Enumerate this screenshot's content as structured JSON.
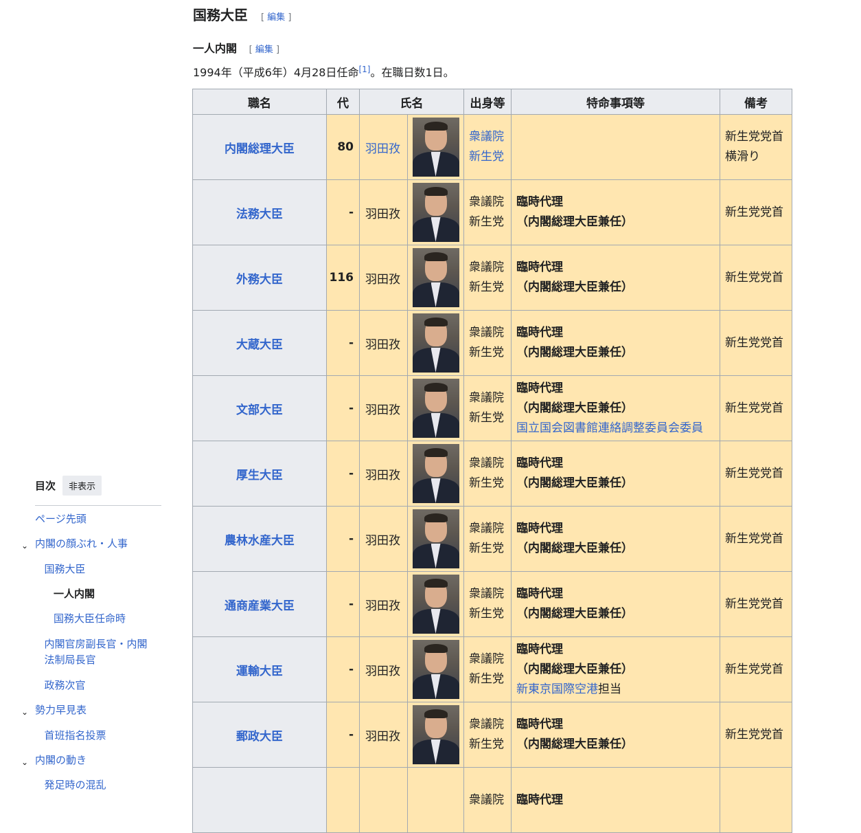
{
  "heading": {
    "title": "国務大臣",
    "edit_open": "[",
    "edit_label": "編集",
    "edit_close": "]"
  },
  "subheading": {
    "title": "一人内閣",
    "edit_open": "[",
    "edit_label": "編集",
    "edit_close": "]"
  },
  "intro": {
    "text": "1994年（平成6年）4月28日任命",
    "ref": "[1]",
    "after": "。在職日数1日。"
  },
  "table": {
    "headers": [
      "職名",
      "代",
      "氏名",
      "出身等",
      "特命事項等",
      "備考"
    ],
    "rows": [
      {
        "post": "内閣総理大臣",
        "num": "80",
        "name": "羽田孜",
        "name_link": true,
        "origin1": "衆議院",
        "origin2": "新生党",
        "origin_link": true,
        "special1": "",
        "special2": "",
        "special3": "",
        "special3_suffix": "",
        "notes1": "新生党党首",
        "notes2": "横滑り"
      },
      {
        "post": "法務大臣",
        "num": "-",
        "name": "羽田孜",
        "origin1": "衆議院",
        "origin2": "新生党",
        "special1": "臨時代理",
        "special2": "（内閣総理大臣兼任）",
        "special3": "",
        "special3_suffix": "",
        "notes1": "新生党党首",
        "notes2": ""
      },
      {
        "post": "外務大臣",
        "num": "116",
        "name": "羽田孜",
        "origin1": "衆議院",
        "origin2": "新生党",
        "special1": "臨時代理",
        "special2": "（内閣総理大臣兼任）",
        "special3": "",
        "special3_suffix": "",
        "notes1": "新生党党首",
        "notes2": ""
      },
      {
        "post": "大蔵大臣",
        "num": "-",
        "name": "羽田孜",
        "origin1": "衆議院",
        "origin2": "新生党",
        "special1": "臨時代理",
        "special2": "（内閣総理大臣兼任）",
        "special3": "",
        "special3_suffix": "",
        "notes1": "新生党党首",
        "notes2": ""
      },
      {
        "post": "文部大臣",
        "num": "-",
        "name": "羽田孜",
        "origin1": "衆議院",
        "origin2": "新生党",
        "special1": "臨時代理",
        "special2": "（内閣総理大臣兼任）",
        "special3": "国立国会図書館連絡調整委員会委員",
        "special3_suffix": "",
        "notes1": "新生党党首",
        "notes2": ""
      },
      {
        "post": "厚生大臣",
        "num": "-",
        "name": "羽田孜",
        "origin1": "衆議院",
        "origin2": "新生党",
        "special1": "臨時代理",
        "special2": "（内閣総理大臣兼任）",
        "special3": "",
        "special3_suffix": "",
        "notes1": "新生党党首",
        "notes2": ""
      },
      {
        "post": "農林水産大臣",
        "num": "-",
        "name": "羽田孜",
        "origin1": "衆議院",
        "origin2": "新生党",
        "special1": "臨時代理",
        "special2": "（内閣総理大臣兼任）",
        "special3": "",
        "special3_suffix": "",
        "notes1": "新生党党首",
        "notes2": ""
      },
      {
        "post": "通商産業大臣",
        "num": "-",
        "name": "羽田孜",
        "origin1": "衆議院",
        "origin2": "新生党",
        "special1": "臨時代理",
        "special2": "（内閣総理大臣兼任）",
        "special3": "",
        "special3_suffix": "",
        "notes1": "新生党党首",
        "notes2": ""
      },
      {
        "post": "運輸大臣",
        "num": "-",
        "name": "羽田孜",
        "origin1": "衆議院",
        "origin2": "新生党",
        "special1": "臨時代理",
        "special2": "（内閣総理大臣兼任）",
        "special3": "新東京国際空港",
        "special3_suffix": "担当",
        "notes1": "新生党党首",
        "notes2": ""
      },
      {
        "post": "郵政大臣",
        "num": "-",
        "name": "羽田孜",
        "origin1": "衆議院",
        "origin2": "新生党",
        "special1": "臨時代理",
        "special2": "（内閣総理大臣兼任）",
        "special3": "",
        "special3_suffix": "",
        "notes1": "新生党党首",
        "notes2": ""
      },
      {
        "post": "",
        "num": "",
        "name": "",
        "origin1": "衆議院",
        "origin2": "",
        "special1": "臨時代理",
        "special2": "",
        "special3": "",
        "special3_suffix": "",
        "notes1": "",
        "notes2": ""
      }
    ]
  },
  "toc": {
    "title": "目次",
    "hide_label": "非表示",
    "items": [
      {
        "label": "ページ先頭",
        "level": 0,
        "chevron": false,
        "active": false
      },
      {
        "label": "内閣の顔ぶれ・人事",
        "level": 0,
        "chevron": true,
        "active": false
      },
      {
        "label": "国務大臣",
        "level": 1,
        "chevron": false,
        "active": false
      },
      {
        "label": "一人内閣",
        "level": 2,
        "chevron": false,
        "active": true
      },
      {
        "label": "国務大臣任命時",
        "level": 2,
        "chevron": false,
        "active": false
      },
      {
        "label": "内閣官房副長官・内閣",
        "label2": "法制局長官",
        "level": 1,
        "chevron": false,
        "active": false
      },
      {
        "label": "政務次官",
        "level": 1,
        "chevron": false,
        "active": false
      },
      {
        "label": "勢力早見表",
        "level": 0,
        "chevron": true,
        "active": false
      },
      {
        "label": "首班指名投票",
        "level": 1,
        "chevron": false,
        "active": false
      },
      {
        "label": "内閣の動き",
        "level": 0,
        "chevron": true,
        "active": false
      },
      {
        "label": "発足時の混乱",
        "level": 1,
        "chevron": false,
        "active": false
      }
    ]
  },
  "colors": {
    "cell_bg": "#ffe6b0",
    "header_bg": "#eaecf0",
    "link": "#3366cc",
    "border": "#a2a9b1"
  }
}
